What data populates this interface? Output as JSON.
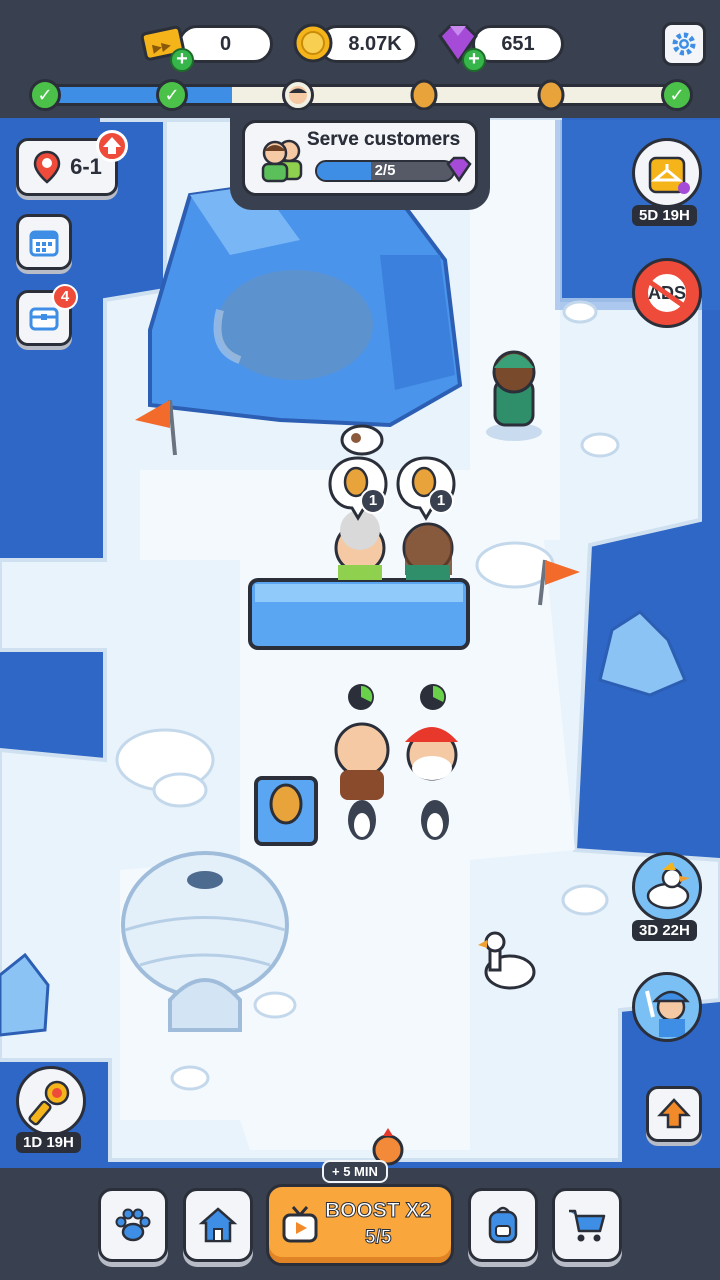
{
  "resources": {
    "tickets": "0",
    "coins": "8.07K",
    "gems": "651"
  },
  "level": {
    "label": "6-1"
  },
  "quest": {
    "title": "Serve customers",
    "progress_text": "2/5",
    "progress": 0.4
  },
  "level_progress": 0.3,
  "calendar_badge": "",
  "inventory_badge": "4",
  "order_bubbles": [
    {
      "item": "egg-icon",
      "count": "1"
    },
    {
      "item": "egg-icon",
      "count": "1"
    }
  ],
  "event_timers": {
    "outfit_event": "5D 19H",
    "duck_event": "3D 22H",
    "torch_event": "1D 19H"
  },
  "boost": {
    "bonus": "+ 5 MIN",
    "label": "BOOST X2",
    "count": "5/5"
  },
  "no_ads_label": "ADS",
  "colors": {
    "water": "#2f67c6",
    "snow": "#e9f3fb",
    "ice": "#3f8de8",
    "accent": "#f9a73c",
    "check": "#4cc14a"
  }
}
